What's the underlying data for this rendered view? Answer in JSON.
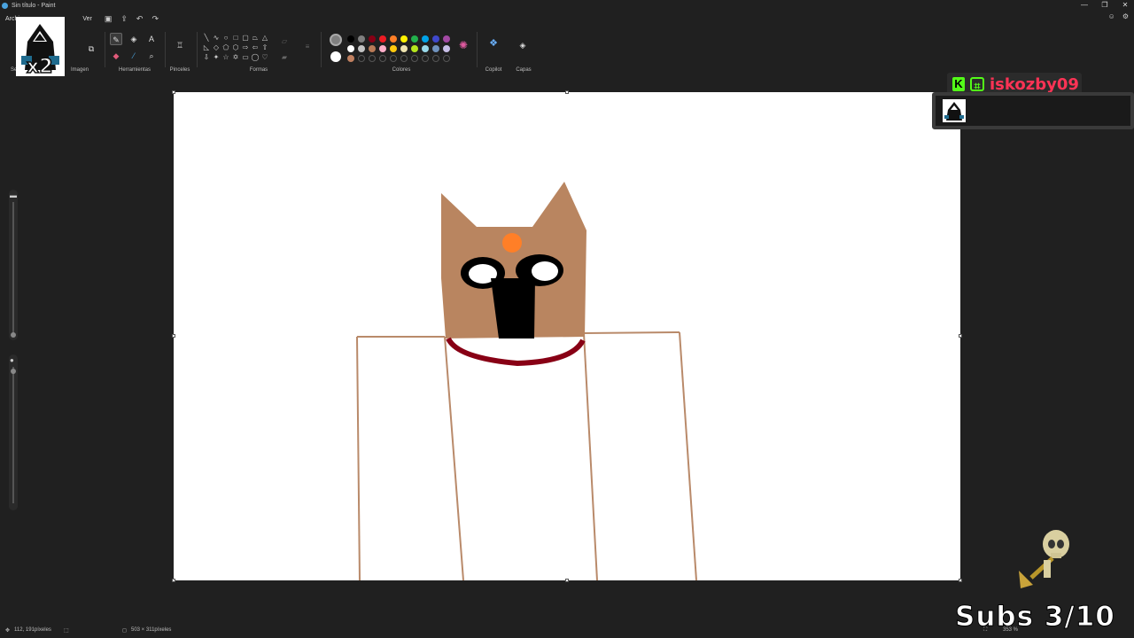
{
  "window": {
    "title": "Sin título - Paint",
    "controls": [
      "—",
      "❐",
      "✕"
    ]
  },
  "menu": {
    "items": [
      "Archivo",
      "Ver"
    ],
    "quick_access": [
      "save-icon",
      "share-icon",
      "undo-icon",
      "redo-icon"
    ]
  },
  "ribbon": {
    "groups": {
      "selection": "Selección",
      "image": "Imagen",
      "tools": "Herramientas",
      "brushes": "Pinceles",
      "shapes": "Formas",
      "colors": "Colores",
      "copilot": "Copilot",
      "layers": "Capas"
    },
    "palette_row1": [
      "#000000",
      "#7f7f7f",
      "#880015",
      "#ed1c24",
      "#ff7f27",
      "#fff200",
      "#22b14c",
      "#00a2e8",
      "#3f48cc",
      "#a349a4"
    ],
    "palette_row2": [
      "#ffffff",
      "#c3c3c3",
      "#b97a57",
      "#ffaec9",
      "#ffc90e",
      "#efe4b0",
      "#b5e61d",
      "#99d9ea",
      "#7092be",
      "#c8bfe7"
    ],
    "palette_row3": [
      "#c08060",
      "",
      "",
      "",
      "",
      "",
      "",
      "",
      "",
      ""
    ],
    "color1": "#808080",
    "color2": "#ffffff"
  },
  "overlay": {
    "multiplier": "x2",
    "kick_user": "iskozby09",
    "subs": "Subs 3/10"
  },
  "status": {
    "cursor": "112, 191píxeles",
    "selection": "",
    "canvas_size": "503 × 311píxeles",
    "zoom": "353 %"
  }
}
